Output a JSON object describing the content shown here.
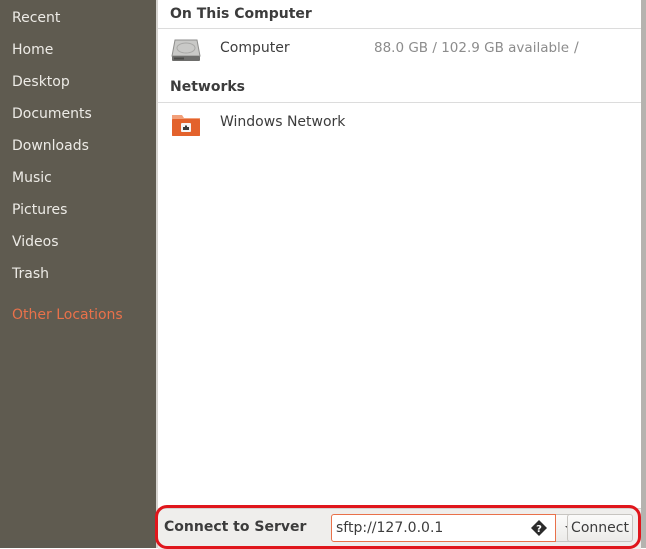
{
  "sidebar": {
    "items": [
      {
        "label": "Recent",
        "active": false
      },
      {
        "label": "Home",
        "active": false
      },
      {
        "label": "Desktop",
        "active": false
      },
      {
        "label": "Documents",
        "active": false
      },
      {
        "label": "Downloads",
        "active": false
      },
      {
        "label": "Music",
        "active": false
      },
      {
        "label": "Pictures",
        "active": false
      },
      {
        "label": "Videos",
        "active": false
      },
      {
        "label": "Trash",
        "active": false
      },
      {
        "label": "Other Locations",
        "active": true
      }
    ]
  },
  "main": {
    "sections": [
      {
        "header": "On This Computer",
        "rows": [
          {
            "icon": "hard-drive-icon",
            "name": "Computer",
            "space": "88.0 GB / 102.9 GB available",
            "mount": "/"
          }
        ]
      },
      {
        "header": "Networks",
        "rows": [
          {
            "icon": "network-folder-icon",
            "name": "Windows Network",
            "space": "",
            "mount": ""
          }
        ]
      }
    ]
  },
  "bottom_bar": {
    "label": "Connect to Server",
    "server_address_value": "sftp://127.0.0.1",
    "help_icon": "help-icon",
    "dropdown_icon": "chevron-down-icon",
    "connect_label": "Connect"
  },
  "colors": {
    "sidebar_bg": "#5f5b50",
    "accent": "#e9714a",
    "highlight": "#e0161c"
  }
}
